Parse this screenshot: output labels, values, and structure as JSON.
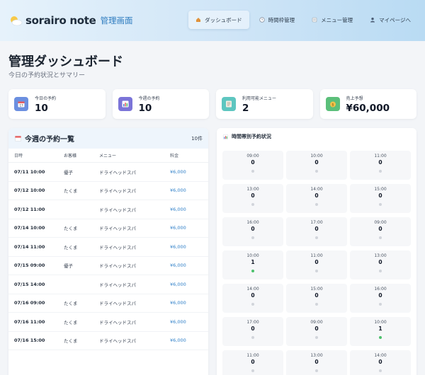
{
  "header": {
    "brand_name": "sorairo note",
    "brand_sub": "管理画面",
    "nav": [
      {
        "label": "ダッシュボード",
        "icon": "home-icon",
        "active": true
      },
      {
        "label": "時間枠管理",
        "icon": "clock-icon",
        "active": false
      },
      {
        "label": "メニュー管理",
        "icon": "menu-list-icon",
        "active": false
      },
      {
        "label": "マイページへ",
        "icon": "user-icon",
        "active": false
      }
    ]
  },
  "page": {
    "title": "管理ダッシュボード",
    "subtitle": "今日の予約状況とサマリー"
  },
  "stats": [
    {
      "label": "今日の予約",
      "value": "10",
      "icon": "calendar-icon",
      "color": "#6b8fe0"
    },
    {
      "label": "今週の予約",
      "value": "10",
      "icon": "chart-icon",
      "color": "#7b74d8"
    },
    {
      "label": "利用可能メニュー",
      "value": "2",
      "icon": "list-icon",
      "color": "#5ec6c0"
    },
    {
      "label": "売上予想",
      "value": "¥60,000",
      "icon": "money-icon",
      "color": "#5bbf7a"
    }
  ],
  "bookings": {
    "title": "今週の予約一覧",
    "count": "10件",
    "columns": [
      "日時",
      "お客様",
      "メニュー",
      "料金"
    ],
    "rows": [
      {
        "datetime": "07/11 10:00",
        "customer": "優子",
        "menu": "ドライヘッドスパ",
        "price": "¥6,000"
      },
      {
        "datetime": "07/12 10:00",
        "customer": "たくま",
        "menu": "ドライヘッドスパ",
        "price": "¥6,000"
      },
      {
        "datetime": "07/12 11:00",
        "customer": "",
        "menu": "ドライヘッドスパ",
        "price": "¥6,000"
      },
      {
        "datetime": "07/14 10:00",
        "customer": "たくま",
        "menu": "ドライヘッドスパ",
        "price": "¥6,000"
      },
      {
        "datetime": "07/14 11:00",
        "customer": "たくま",
        "menu": "ドライヘッドスパ",
        "price": "¥6,000"
      },
      {
        "datetime": "07/15 09:00",
        "customer": "優子",
        "menu": "ドライヘッドスパ",
        "price": "¥6,000"
      },
      {
        "datetime": "07/15 14:00",
        "customer": "",
        "menu": "ドライヘッドスパ",
        "price": "¥6,000"
      },
      {
        "datetime": "07/16 09:00",
        "customer": "たくま",
        "menu": "ドライヘッドスパ",
        "price": "¥6,000"
      },
      {
        "datetime": "07/16 11:00",
        "customer": "たくま",
        "menu": "ドライヘッドスパ",
        "price": "¥6,000"
      },
      {
        "datetime": "07/16 15:00",
        "customer": "たくま",
        "menu": "ドライヘッドスパ",
        "price": "¥6,000"
      }
    ]
  },
  "slots": {
    "title": "時間帯別予約状況",
    "items": [
      {
        "time": "09:00",
        "count": "0",
        "active": false
      },
      {
        "time": "10:00",
        "count": "0",
        "active": false
      },
      {
        "time": "11:00",
        "count": "0",
        "active": false
      },
      {
        "time": "13:00",
        "count": "0",
        "active": false
      },
      {
        "time": "14:00",
        "count": "0",
        "active": false
      },
      {
        "time": "15:00",
        "count": "0",
        "active": false
      },
      {
        "time": "16:00",
        "count": "0",
        "active": false
      },
      {
        "time": "17:00",
        "count": "0",
        "active": false
      },
      {
        "time": "09:00",
        "count": "0",
        "active": false
      },
      {
        "time": "10:00",
        "count": "1",
        "active": true
      },
      {
        "time": "11:00",
        "count": "0",
        "active": false
      },
      {
        "time": "13:00",
        "count": "0",
        "active": false
      },
      {
        "time": "14:00",
        "count": "0",
        "active": false
      },
      {
        "time": "15:00",
        "count": "0",
        "active": false
      },
      {
        "time": "16:00",
        "count": "0",
        "active": false
      },
      {
        "time": "17:00",
        "count": "0",
        "active": false
      },
      {
        "time": "09:00",
        "count": "0",
        "active": false
      },
      {
        "time": "10:00",
        "count": "1",
        "active": true
      },
      {
        "time": "11:00",
        "count": "0",
        "active": false
      },
      {
        "time": "13:00",
        "count": "0",
        "active": false
      },
      {
        "time": "14:00",
        "count": "0",
        "active": false
      }
    ]
  }
}
